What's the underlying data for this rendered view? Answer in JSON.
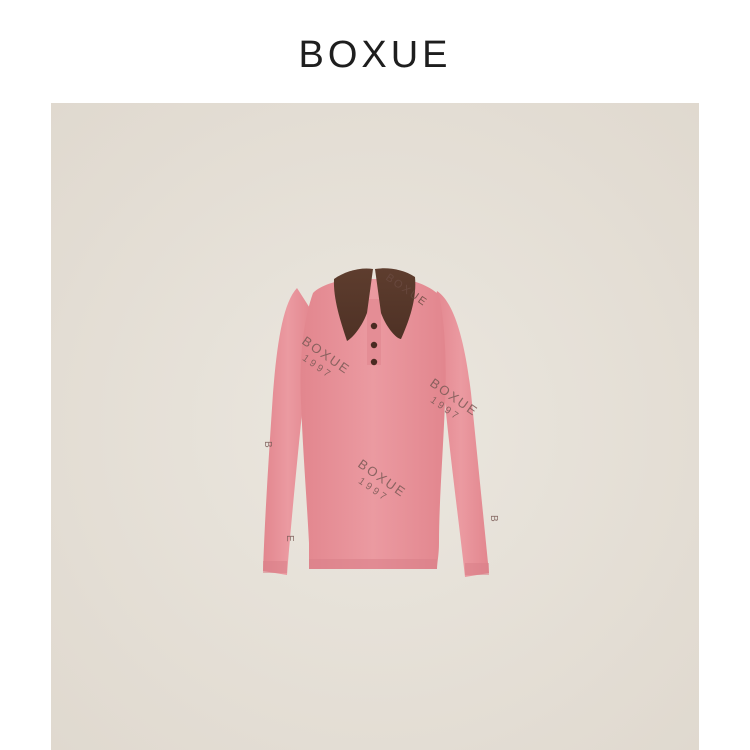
{
  "brand": {
    "title": "BOXUE"
  },
  "product_photo": {
    "description_icon": "pink-polo-knit-top-icon",
    "print_brand": "BOXUE",
    "print_year": "1997",
    "colors": {
      "background": "#e6e1d9",
      "body": "#e8939a",
      "collar": "#5a3a2c",
      "buttons": "#4a2a22",
      "print": "#7a5a56"
    }
  }
}
